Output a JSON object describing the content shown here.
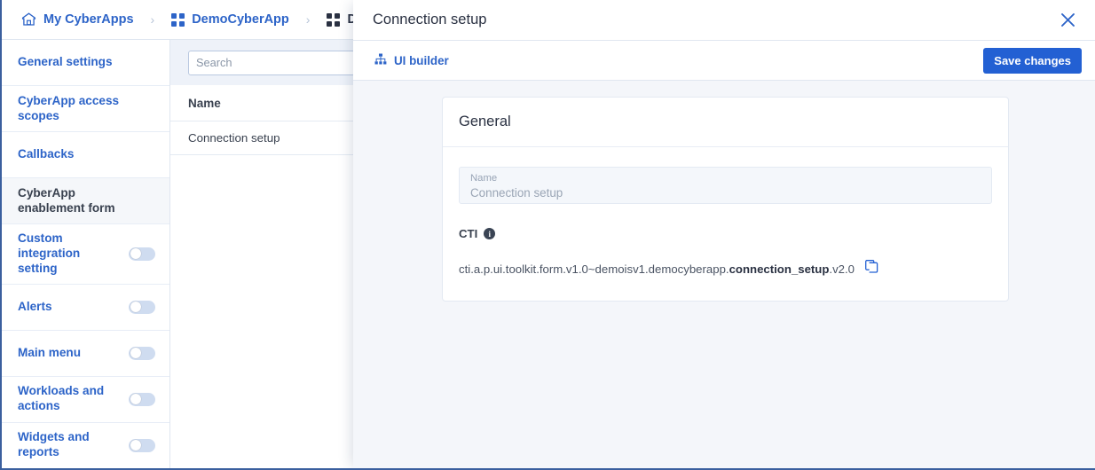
{
  "breadcrumb": {
    "items": [
      {
        "label": "My CyberApps",
        "icon": "home-icon",
        "current": false
      },
      {
        "label": "DemoCyberApp",
        "icon": "grid-icon",
        "current": false
      },
      {
        "label": "DemoCyb",
        "icon": "grid-icon",
        "current": true
      }
    ],
    "separator": "›"
  },
  "sidebar": {
    "items": [
      {
        "label": "General settings",
        "toggle": false,
        "active": false
      },
      {
        "label": "CyberApp access scopes",
        "toggle": false,
        "active": false
      },
      {
        "label": "Callbacks",
        "toggle": false,
        "active": false
      },
      {
        "label": "CyberApp enablement form",
        "toggle": false,
        "active": true
      },
      {
        "label": "Custom integration setting",
        "toggle": true,
        "toggle_on": false,
        "active": false
      },
      {
        "label": "Alerts",
        "toggle": true,
        "toggle_on": false,
        "active": false
      },
      {
        "label": "Main menu",
        "toggle": true,
        "toggle_on": false,
        "active": false
      },
      {
        "label": "Workloads and actions",
        "toggle": true,
        "toggle_on": false,
        "active": false
      },
      {
        "label": "Widgets and reports",
        "toggle": true,
        "toggle_on": false,
        "active": false
      }
    ]
  },
  "list_pane": {
    "search_placeholder": "Search",
    "search_value": "",
    "search_icon": "search-icon",
    "column_header": "Name",
    "rows": [
      {
        "name": "Connection setup"
      }
    ]
  },
  "panel": {
    "title": "Connection setup",
    "close_icon": "close-icon",
    "tab_label": "UI builder",
    "tab_icon": "hierarchy-icon",
    "save_label": "Save changes",
    "card": {
      "title": "General",
      "name_field": {
        "label": "Name",
        "value": "Connection setup"
      },
      "cti": {
        "label": "CTI",
        "info_icon": "info-icon",
        "value_prefix": "cti.a.p.ui.toolkit.form.v1.0~demoisv1.democyberapp.",
        "value_bold": "connection_setup",
        "value_suffix": ".v2.0",
        "copy_icon": "copy-icon"
      }
    }
  },
  "colors": {
    "accent_blue": "#2d64c8",
    "button_blue": "#2360d3",
    "panel_bg": "#f4f6fa",
    "text_dark": "#2a3142",
    "border_blue": "#3a5f9e"
  }
}
